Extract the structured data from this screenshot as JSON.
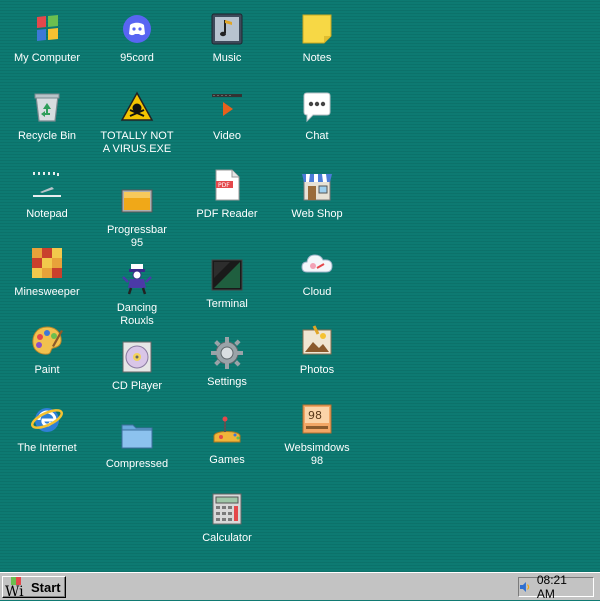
{
  "desktop": {
    "background": "#0d7a72",
    "columns": [
      [
        {
          "label": "My Computer",
          "icon": "my-computer-icon"
        },
        {
          "label": "Recycle Bin",
          "icon": "recycle-bin-icon"
        },
        {
          "label": "Notepad",
          "icon": "notepad-icon"
        },
        {
          "label": "Minesweeper",
          "icon": "minesweeper-icon"
        },
        {
          "label": "Paint",
          "icon": "paint-icon"
        },
        {
          "label": "The Internet",
          "icon": "internet-icon"
        }
      ],
      [
        {
          "label": "95cord",
          "icon": "discord-icon"
        },
        {
          "label": "TOTALLY NOT A VIRUS.EXE",
          "icon": "warning-skull-icon"
        },
        {
          "label": "Progressbar 95",
          "icon": "progressbar-icon"
        },
        {
          "label": "Dancing Rouxls",
          "icon": "dancing-character-icon"
        },
        {
          "label": "CD Player",
          "icon": "cd-player-icon"
        },
        {
          "label": "Compressed",
          "icon": "folder-icon"
        }
      ],
      [
        {
          "label": "Music",
          "icon": "music-icon"
        },
        {
          "label": "Video",
          "icon": "video-icon"
        },
        {
          "label": "PDF Reader",
          "icon": "pdf-icon"
        },
        {
          "label": "Terminal",
          "icon": "terminal-icon"
        },
        {
          "label": "Settings",
          "icon": "gear-icon"
        },
        {
          "label": "Games",
          "icon": "games-icon"
        },
        {
          "label": "Calculator",
          "icon": "calculator-icon"
        }
      ],
      [
        {
          "label": "Notes",
          "icon": "sticky-note-icon"
        },
        {
          "label": "Chat",
          "icon": "chat-bubble-icon"
        },
        {
          "label": "Web Shop",
          "icon": "shop-icon"
        },
        {
          "label": "Cloud",
          "icon": "cloud-icon"
        },
        {
          "label": "Photos",
          "icon": "photos-icon"
        },
        {
          "label": "Websimdows 98",
          "icon": "websimdows-icon"
        }
      ]
    ]
  },
  "taskbar": {
    "start_label": "Start",
    "start_logo_text": "Wi",
    "clock": "08:21 AM",
    "tray_icon": "volume-icon"
  }
}
